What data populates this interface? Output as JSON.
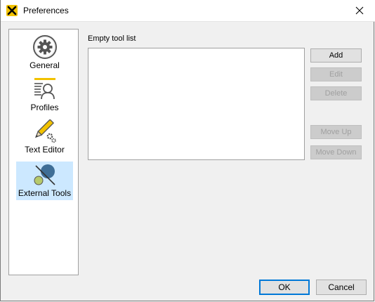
{
  "window": {
    "title": "Preferences"
  },
  "sidebar": {
    "items": [
      {
        "label": "General",
        "icon": "gear-icon",
        "selected": false
      },
      {
        "label": "Profiles",
        "icon": "profile-card-icon",
        "selected": false
      },
      {
        "label": "Text Editor",
        "icon": "pencil-gears-icon",
        "selected": false
      },
      {
        "label": "External Tools",
        "icon": "external-tools-icon",
        "selected": true
      }
    ]
  },
  "tools": {
    "list_label": "Empty tool list",
    "items": [],
    "buttons": {
      "add": "Add",
      "edit": "Edit",
      "delete": "Delete",
      "move_up": "Move Up",
      "move_down": "Move Down"
    }
  },
  "dialog": {
    "ok": "OK",
    "cancel": "Cancel"
  },
  "colors": {
    "accent": "#0078d7",
    "selection": "#cce8ff",
    "app_icon": "#f2c200"
  }
}
